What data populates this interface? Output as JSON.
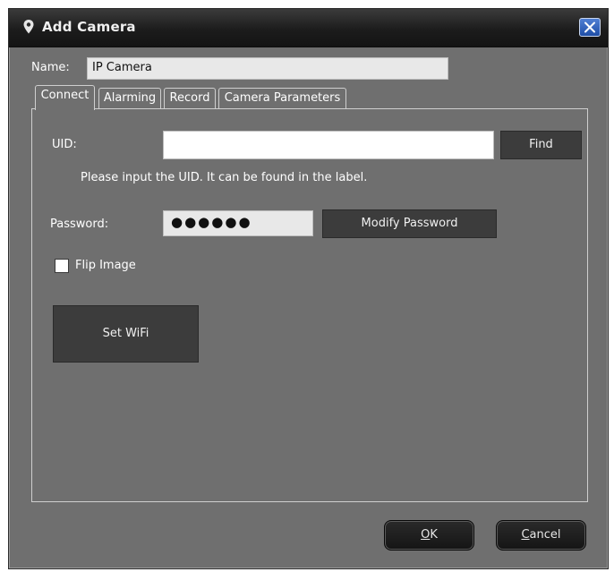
{
  "window": {
    "title": "Add Camera",
    "title_icon": "location-pin-icon",
    "close_icon": "close-icon"
  },
  "name": {
    "label": "Name:",
    "value": "IP Camera"
  },
  "tabs": [
    {
      "label": "Connect",
      "active": true
    },
    {
      "label": "Alarming",
      "active": false
    },
    {
      "label": "Record",
      "active": false
    },
    {
      "label": "Camera Parameters",
      "active": false
    }
  ],
  "connect": {
    "uid_label": "UID:",
    "uid_value": "",
    "find_label": "Find",
    "hint": "Please input the UID. It can be found in the label.",
    "password_label": "Password:",
    "password_mask": "●●●●●●",
    "modify_password_label": "Modify Password",
    "flip_image_label": "Flip Image",
    "flip_image_checked": false,
    "set_wifi_label": "Set WiFi"
  },
  "footer": {
    "ok_mnemonic": "O",
    "ok_rest": "K",
    "cancel_mnemonic": "C",
    "cancel_rest": "ancel"
  },
  "colors": {
    "window_bg": "#6f6f6f",
    "titlebar": "#1c1c1c",
    "button_bg": "#3c3c3c",
    "close_button": "#2f63c2"
  }
}
